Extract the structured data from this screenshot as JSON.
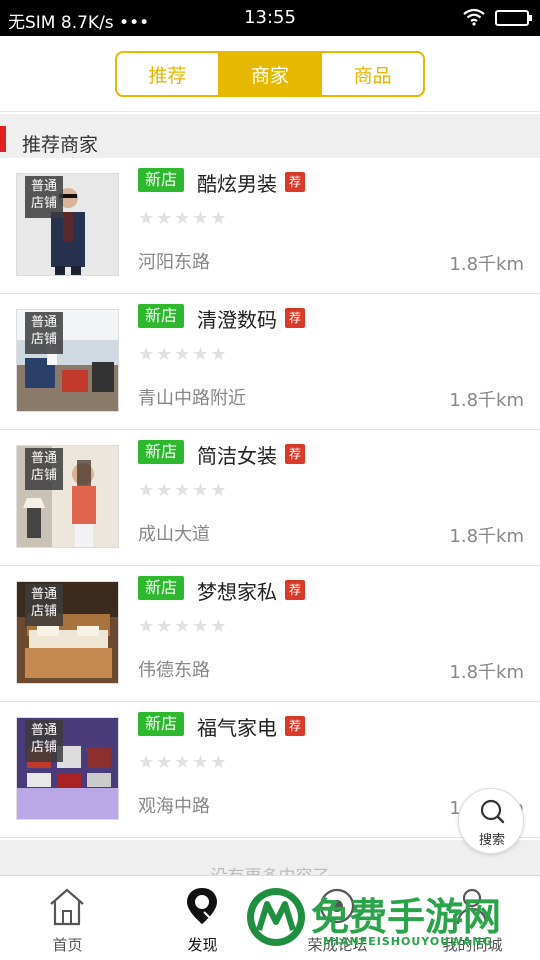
{
  "status_bar": {
    "carrier": "无SIM",
    "speed": "8.7K/s •••",
    "time": "13:55"
  },
  "segments": [
    {
      "label": "推荐",
      "active": false
    },
    {
      "label": "商家",
      "active": true
    },
    {
      "label": "商品",
      "active": false
    }
  ],
  "section": {
    "title": "推荐商家"
  },
  "shop_badge": "普通店铺",
  "new_tag": "新店",
  "rec_tag": "荐",
  "stars": "★★★★★",
  "shops": [
    {
      "name": "酷炫男装",
      "address": "河阳东路",
      "distance": "1.8千km",
      "rating": 0
    },
    {
      "name": "清澄数码",
      "address": "青山中路附近",
      "distance": "1.8千km",
      "rating": 0
    },
    {
      "name": "简洁女装",
      "address": "成山大道",
      "distance": "1.8千km",
      "rating": 0
    },
    {
      "name": "梦想家私",
      "address": "伟德东路",
      "distance": "1.8千km",
      "rating": 0
    },
    {
      "name": "福气家电",
      "address": "观海中路",
      "distance": "1.8千km",
      "rating": 0
    }
  ],
  "footer_message": "没有更多内容了",
  "search_button": {
    "label": "搜索"
  },
  "tabs": [
    {
      "label": "首页",
      "icon": "home-icon"
    },
    {
      "label": "发现",
      "icon": "location-pin-icon"
    },
    {
      "label": "荣成论坛",
      "icon": "forum-icon"
    },
    {
      "label": "我的同城",
      "icon": "user-icon"
    }
  ],
  "watermark": {
    "title": "免费手游网",
    "url": "MIANFEISHOUYOUWANG"
  }
}
